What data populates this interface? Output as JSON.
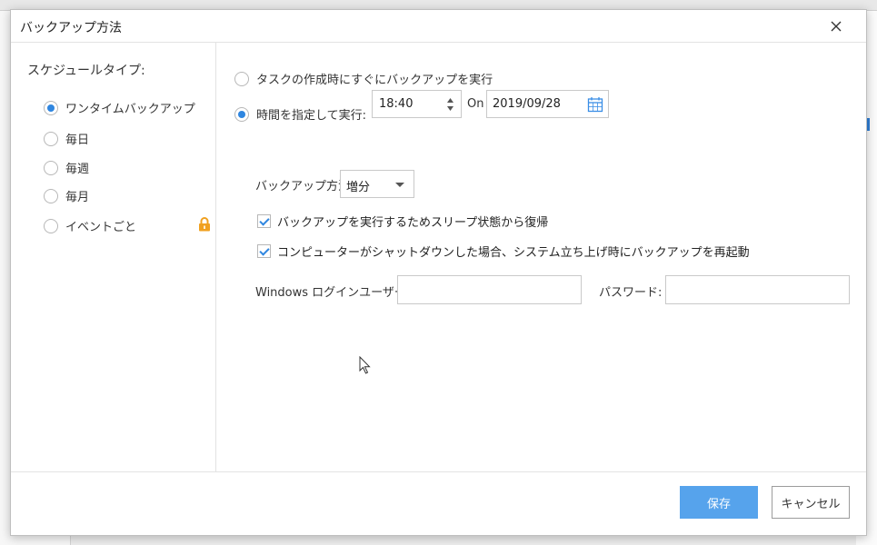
{
  "dialog": {
    "title": "バックアップ方法",
    "close_icon": "close-icon"
  },
  "schedule": {
    "label": "スケジュールタイプ:",
    "options": [
      {
        "label": "ワンタイムバックアップ",
        "selected": true
      },
      {
        "label": "毎日",
        "selected": false
      },
      {
        "label": "毎週",
        "selected": false
      },
      {
        "label": "毎月",
        "selected": false
      },
      {
        "label": "イベントごと",
        "selected": false,
        "locked": true
      }
    ]
  },
  "run": {
    "immediate_label": "タスクの作成時にすぐにバックアップを実行",
    "immediate_selected": false,
    "scheduled_label": "時間を指定して実行:",
    "scheduled_selected": true,
    "time": "18:40",
    "on_label": "On",
    "date": "2019/09/28"
  },
  "method": {
    "label": "バックアップ方法",
    "value": "増分"
  },
  "checkboxes": [
    {
      "label": "バックアップを実行するためスリープ状態から復帰",
      "checked": true
    },
    {
      "label": "コンピューターがシャットダウンした場合、システム立ち上げ時にバックアップを再起動",
      "checked": true
    }
  ],
  "credentials": {
    "login_label": "Windows ログインユーザー:",
    "login_value": "",
    "password_label": "パスワード:",
    "password_value": ""
  },
  "footer": {
    "save_label": "保存",
    "cancel_label": "キャンセル"
  },
  "colors": {
    "accent": "#2f86e0",
    "save_button": "#56a3ec",
    "lock": "#f0a020"
  }
}
